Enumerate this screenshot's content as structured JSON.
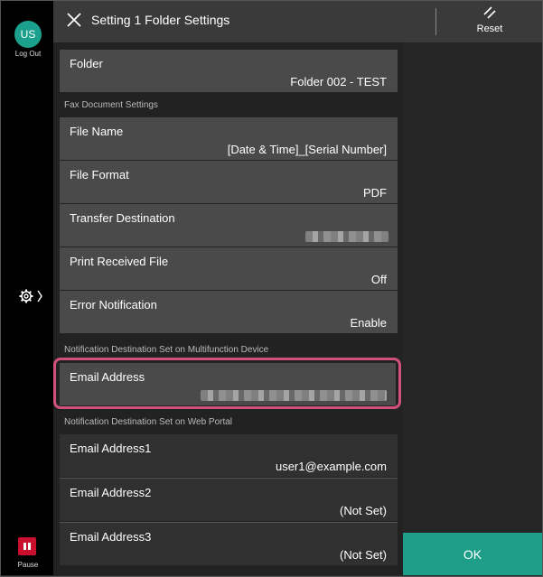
{
  "user": {
    "initials": "US",
    "logout_label": "Log Out"
  },
  "header": {
    "title": "Setting 1 Folder Settings",
    "reset_label": "Reset"
  },
  "folder": {
    "label": "Folder",
    "value": "Folder 002 - TEST"
  },
  "fax_section": {
    "heading": "Fax Document Settings",
    "items": [
      {
        "label": "File Name",
        "value": "[Date & Time]_[Serial Number]"
      },
      {
        "label": "File Format",
        "value": "PDF"
      },
      {
        "label": "Transfer Destination",
        "value": ""
      },
      {
        "label": "Print Received File",
        "value": "Off"
      },
      {
        "label": "Error Notification",
        "value": "Enable"
      }
    ]
  },
  "mfd_section": {
    "heading": "Notification Destination Set on Multifunction Device",
    "email_label": "Email Address"
  },
  "portal_section": {
    "heading": "Notification Destination Set on Web Portal",
    "items": [
      {
        "label": "Email Address1",
        "value": "user1@example.com"
      },
      {
        "label": "Email Address2",
        "value": "(Not Set)"
      },
      {
        "label": "Email Address3",
        "value": "(Not Set)"
      }
    ]
  },
  "footer": {
    "pause_label": "Pause",
    "ok_label": "OK"
  },
  "colors": {
    "accent": "#1e9e89",
    "avatar": "#1aa08c",
    "pause": "#c8102e",
    "highlight": "#d1507e"
  },
  "icons": [
    "close-icon",
    "reset-icon",
    "gear-icon",
    "chevron-right-icon",
    "pause-icon"
  ]
}
